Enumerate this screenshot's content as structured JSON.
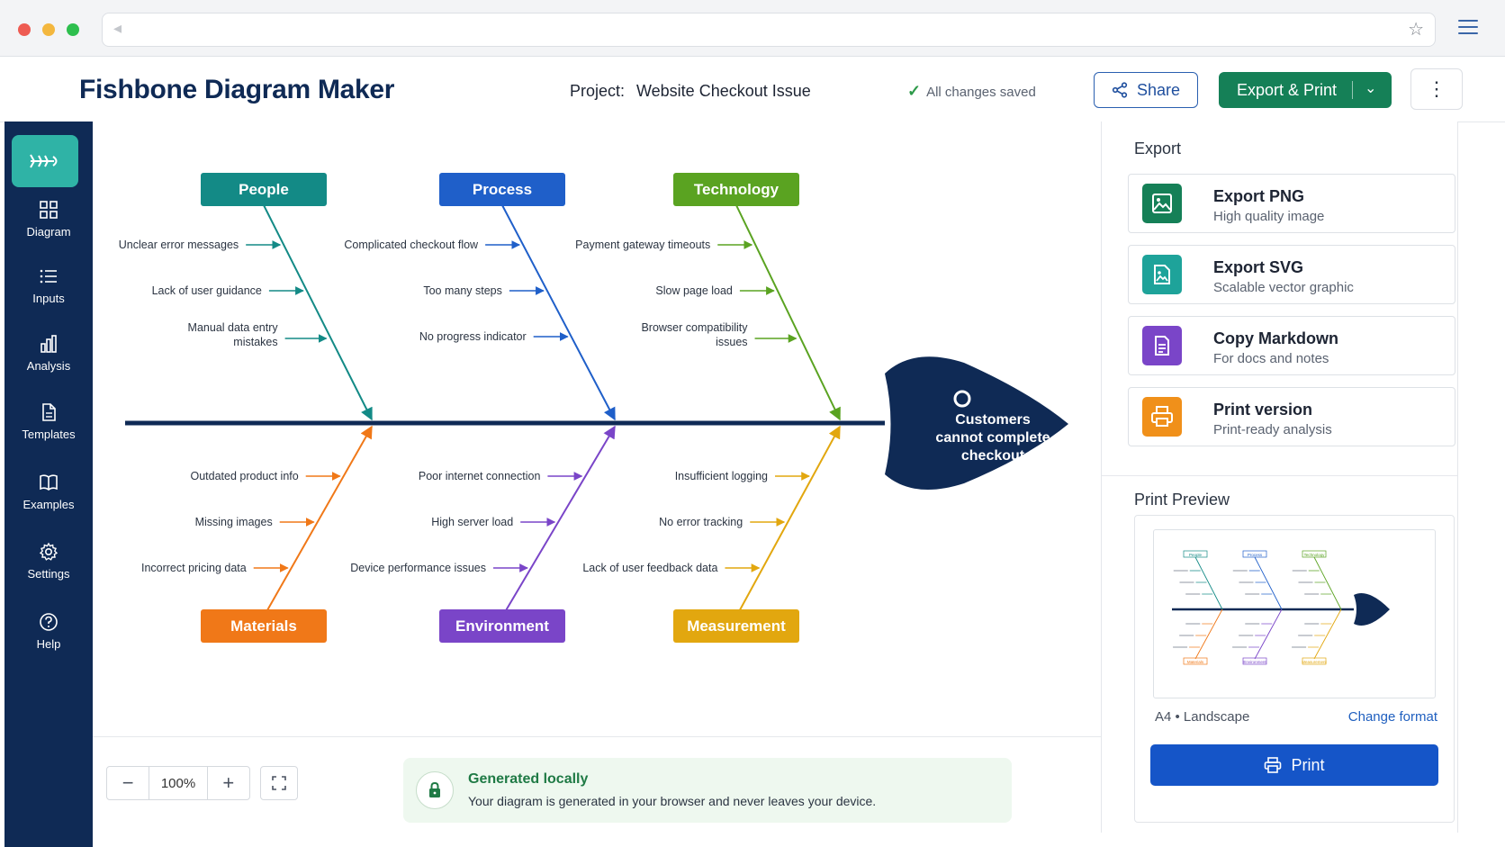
{
  "app": {
    "title": "Fishbone Diagram Maker",
    "project_label": "Project:",
    "project_name": "Website Checkout Issue",
    "save_status": "All changes saved",
    "share_label": "Share",
    "export_label": "Export & Print"
  },
  "sidebar": {
    "items": [
      {
        "label": "Diagram",
        "icon": "grid-icon"
      },
      {
        "label": "Inputs",
        "icon": "list-icon"
      },
      {
        "label": "Analysis",
        "icon": "bar-chart-icon"
      },
      {
        "label": "Templates",
        "icon": "document-icon"
      },
      {
        "label": "Examples",
        "icon": "book-icon"
      },
      {
        "label": "Settings",
        "icon": "gear-icon"
      },
      {
        "label": "Help",
        "icon": "help-icon"
      }
    ]
  },
  "diagram": {
    "head": [
      "Customers",
      "cannot complete",
      "checkout"
    ],
    "categories": [
      {
        "name": "People",
        "color": "#138a86",
        "causes": [
          "Unclear error messages",
          "Lack of user guidance",
          "Manual data entry|mistakes"
        ]
      },
      {
        "name": "Process",
        "color": "#1f5fc9",
        "causes": [
          "Complicated checkout flow",
          "Too many steps",
          "No progress indicator"
        ]
      },
      {
        "name": "Technology",
        "color": "#5aa321",
        "causes": [
          "Payment gateway timeouts",
          "Slow page load",
          "Browser compatibility|issues"
        ]
      },
      {
        "name": "Materials",
        "color": "#f07818",
        "causes": [
          "Outdated product info",
          "Missing images",
          "Incorrect pricing data"
        ]
      },
      {
        "name": "Environment",
        "color": "#7a45c8",
        "causes": [
          "Poor internet connection",
          "High server load",
          "Device performance issues"
        ]
      },
      {
        "name": "Measurement",
        "color": "#e2a70f",
        "causes": [
          "Insufficient logging",
          "No error tracking",
          "Lack of user feedback data"
        ]
      }
    ],
    "spine_color": "#0f2a55"
  },
  "toolbar": {
    "zoom_out": "−",
    "zoom": "100%",
    "zoom_in": "+"
  },
  "notice": {
    "title": "Generated locally",
    "text": "Your diagram is generated in your browser and never leaves your device."
  },
  "export_panel": {
    "title": "Export",
    "options": [
      {
        "title": "Export PNG",
        "subtitle": "High quality image",
        "color": "#158057",
        "icon": "image-icon"
      },
      {
        "title": "Export SVG",
        "subtitle": "Scalable vector graphic",
        "color": "#1ea39a",
        "icon": "vector-image-icon"
      },
      {
        "title": "Copy Markdown",
        "subtitle": "For docs and notes",
        "color": "#7a45c8",
        "icon": "markdown-doc-icon"
      },
      {
        "title": "Print version",
        "subtitle": "Print-ready analysis",
        "color": "#f0901a",
        "icon": "printer-icon"
      }
    ]
  },
  "print_preview": {
    "title": "Print Preview",
    "format": "A4 • Landscape",
    "change_format": "Change format",
    "print_label": "Print",
    "thumbnail_labels": [
      "People",
      "Process",
      "Technology",
      "Materials",
      "Environment",
      "Measurement"
    ]
  }
}
